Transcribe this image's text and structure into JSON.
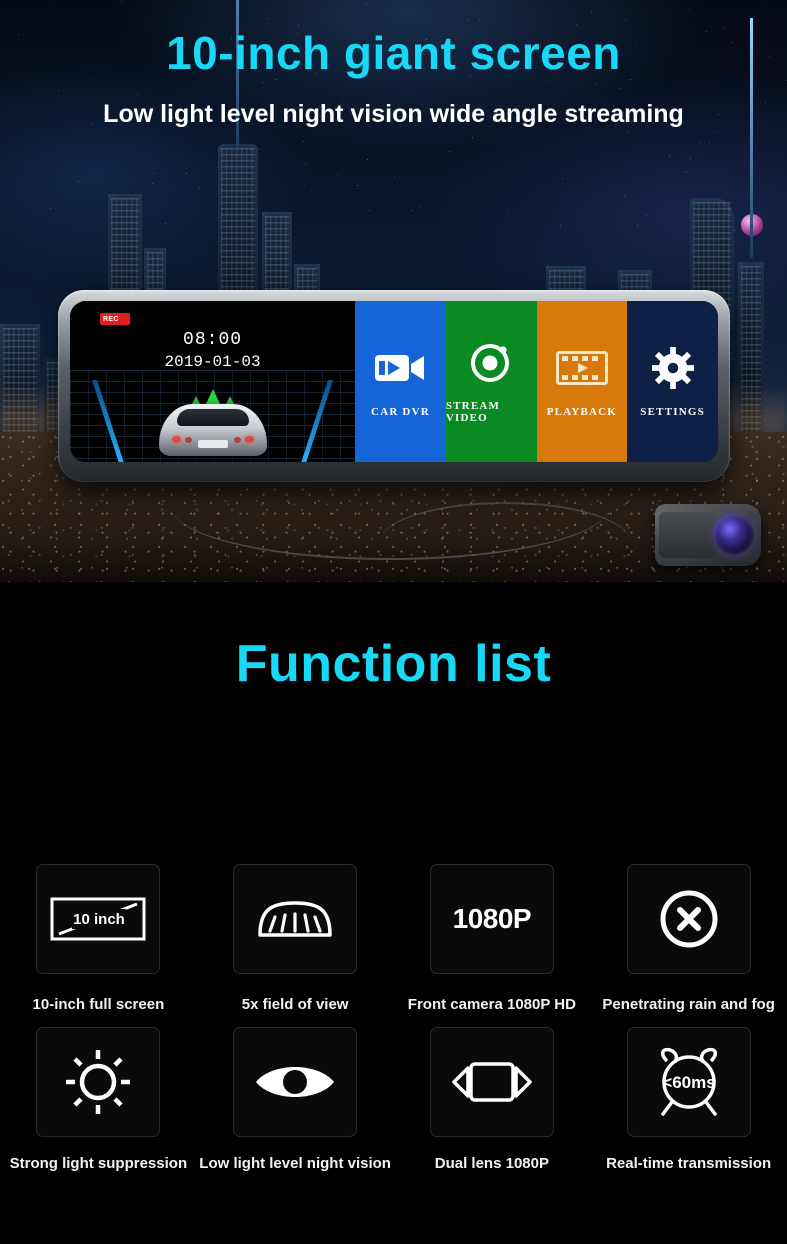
{
  "hero": {
    "title": "10-inch giant screen",
    "subtitle": "Low light level night vision wide angle streaming",
    "title_color": "#19d8f5",
    "device": {
      "rec_badge": "REC",
      "time": "08:00",
      "date": "2019-01-03",
      "menu": [
        {
          "label": "CAR  DVR",
          "icon": "video-camera-icon",
          "color": "#1565d8"
        },
        {
          "label": "STREAM VIDEO",
          "icon": "camera-lens-icon",
          "color": "#0a8a23"
        },
        {
          "label": "PLAYBACK",
          "icon": "film-strip-icon",
          "color": "#d77a0b"
        },
        {
          "label": "SETTINGS",
          "icon": "gear-icon",
          "color": "#0d2147"
        }
      ]
    }
  },
  "functions": {
    "title": "Function list",
    "title_color": "#19d8f5",
    "items": [
      {
        "caption": "10-inch full screen",
        "icon": "screen-diagonal-icon",
        "icon_text": "10 inch"
      },
      {
        "caption": "5x field of view",
        "icon": "wide-angle-lane-icon",
        "icon_text": ""
      },
      {
        "caption": "Front camera 1080P HD",
        "icon": "resolution-text-icon",
        "icon_text": "1080P"
      },
      {
        "caption": "Penetrating rain and fog",
        "icon": "circle-x-icon",
        "icon_text": ""
      },
      {
        "caption": "Strong light suppression",
        "icon": "sun-brightness-icon",
        "icon_text": ""
      },
      {
        "caption": "Low light level night vision",
        "icon": "eye-icon",
        "icon_text": ""
      },
      {
        "caption": "Dual lens 1080P",
        "icon": "dual-lens-icon",
        "icon_text": ""
      },
      {
        "caption": "Real-time transmission",
        "icon": "alarm-clock-icon",
        "icon_text": "<60ms"
      }
    ]
  }
}
